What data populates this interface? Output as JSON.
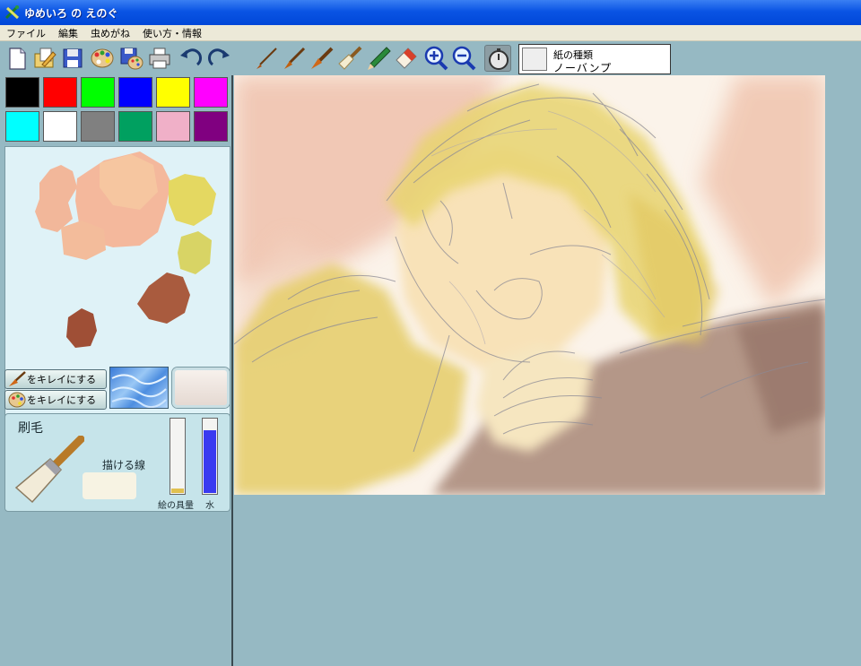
{
  "window": {
    "title": "ゆめいろ の えのぐ"
  },
  "menu": {
    "items": [
      "ファイル",
      "編集",
      "虫めがね",
      "使い方・情報"
    ]
  },
  "toolbar": {
    "file_tools": [
      "new-page",
      "open",
      "save",
      "palette",
      "save-palette",
      "print",
      "undo",
      "redo"
    ],
    "brushes": [
      "thin-brush",
      "medium-brush",
      "thick-brush",
      "flat-brush",
      "pencil",
      "eraser"
    ],
    "zoom": [
      "zoom-in",
      "zoom-out"
    ],
    "timer": "timer",
    "paper": {
      "label": "紙の種類",
      "value": "ノーバンプ"
    }
  },
  "palette": {
    "colors": [
      "#000000",
      "#ff0000",
      "#00ff00",
      "#0000ff",
      "#ffff00",
      "#ff00ff",
      "#00ffff",
      "#ffffff",
      "#808080",
      "#00a060",
      "#f0b0c8",
      "#800080"
    ]
  },
  "clean": {
    "brush_label": "をキレイにする",
    "palette_label": "をキレイにする"
  },
  "brush": {
    "name": "刷毛",
    "line_label": "描ける線"
  },
  "gauges": {
    "paint_label": "絵の具量",
    "paint_level": 0.06,
    "water_label": "水",
    "water_level": 0.83,
    "paint_color": "#e0c050",
    "water_color": "#3a3af0"
  }
}
